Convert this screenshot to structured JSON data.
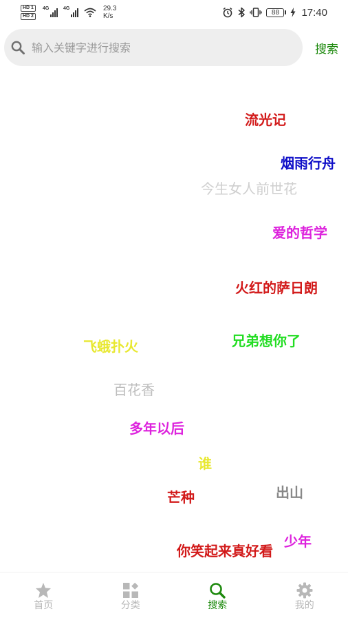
{
  "status_bar": {
    "hd1": "HD 1",
    "hd2": "HD 2",
    "sim1_network": "4G",
    "sim2_network": "4G",
    "network_speed_value": "29.3",
    "network_speed_unit": "K/s",
    "battery": "88",
    "time": "17:40",
    "icons": [
      "alarm-icon",
      "bluetooth-icon",
      "vibrate-icon",
      "battery-icon",
      "charging-icon",
      "wifi-icon"
    ]
  },
  "search": {
    "placeholder": "输入关键字进行搜索",
    "value": "",
    "button_label": "搜索",
    "accent_color": "#1e8a0e"
  },
  "hot_tags": [
    {
      "label": "流光记",
      "color": "#d21a1a",
      "bold": true
    },
    {
      "label": "烟雨行舟",
      "color": "#1010c8",
      "bold": true
    },
    {
      "label": "今生女人前世花",
      "color": "#cfcfcf",
      "bold": false
    },
    {
      "label": "爱的哲学",
      "color": "#dd22dd",
      "bold": true
    },
    {
      "label": "火红的萨日朗",
      "color": "#d21a1a",
      "bold": true
    },
    {
      "label": "兄弟想你了",
      "color": "#22dd22",
      "bold": true
    },
    {
      "label": "飞蛾扑火",
      "color": "#e8e830",
      "bold": true
    },
    {
      "label": "百花香",
      "color": "#bdbdbd",
      "bold": false
    },
    {
      "label": "多年以后",
      "color": "#dd22dd",
      "bold": true
    },
    {
      "label": "谁",
      "color": "#e8e830",
      "bold": true
    },
    {
      "label": "芒种",
      "color": "#d21a1a",
      "bold": true
    },
    {
      "label": "出山",
      "color": "#888888",
      "bold": true
    },
    {
      "label": "少年",
      "color": "#dd22dd",
      "bold": true
    },
    {
      "label": "你笑起来真好看",
      "color": "#d21a1a",
      "bold": true
    }
  ],
  "bottom_nav": {
    "active_color": "#1e8a0e",
    "inactive_color": "#b8b8b8",
    "items": [
      {
        "label": "首页",
        "icon": "star-home-icon",
        "active": false
      },
      {
        "label": "分类",
        "icon": "category-grid-icon",
        "active": false
      },
      {
        "label": "搜索",
        "icon": "search-icon",
        "active": true
      },
      {
        "label": "我的",
        "icon": "gear-icon",
        "active": false
      }
    ]
  }
}
